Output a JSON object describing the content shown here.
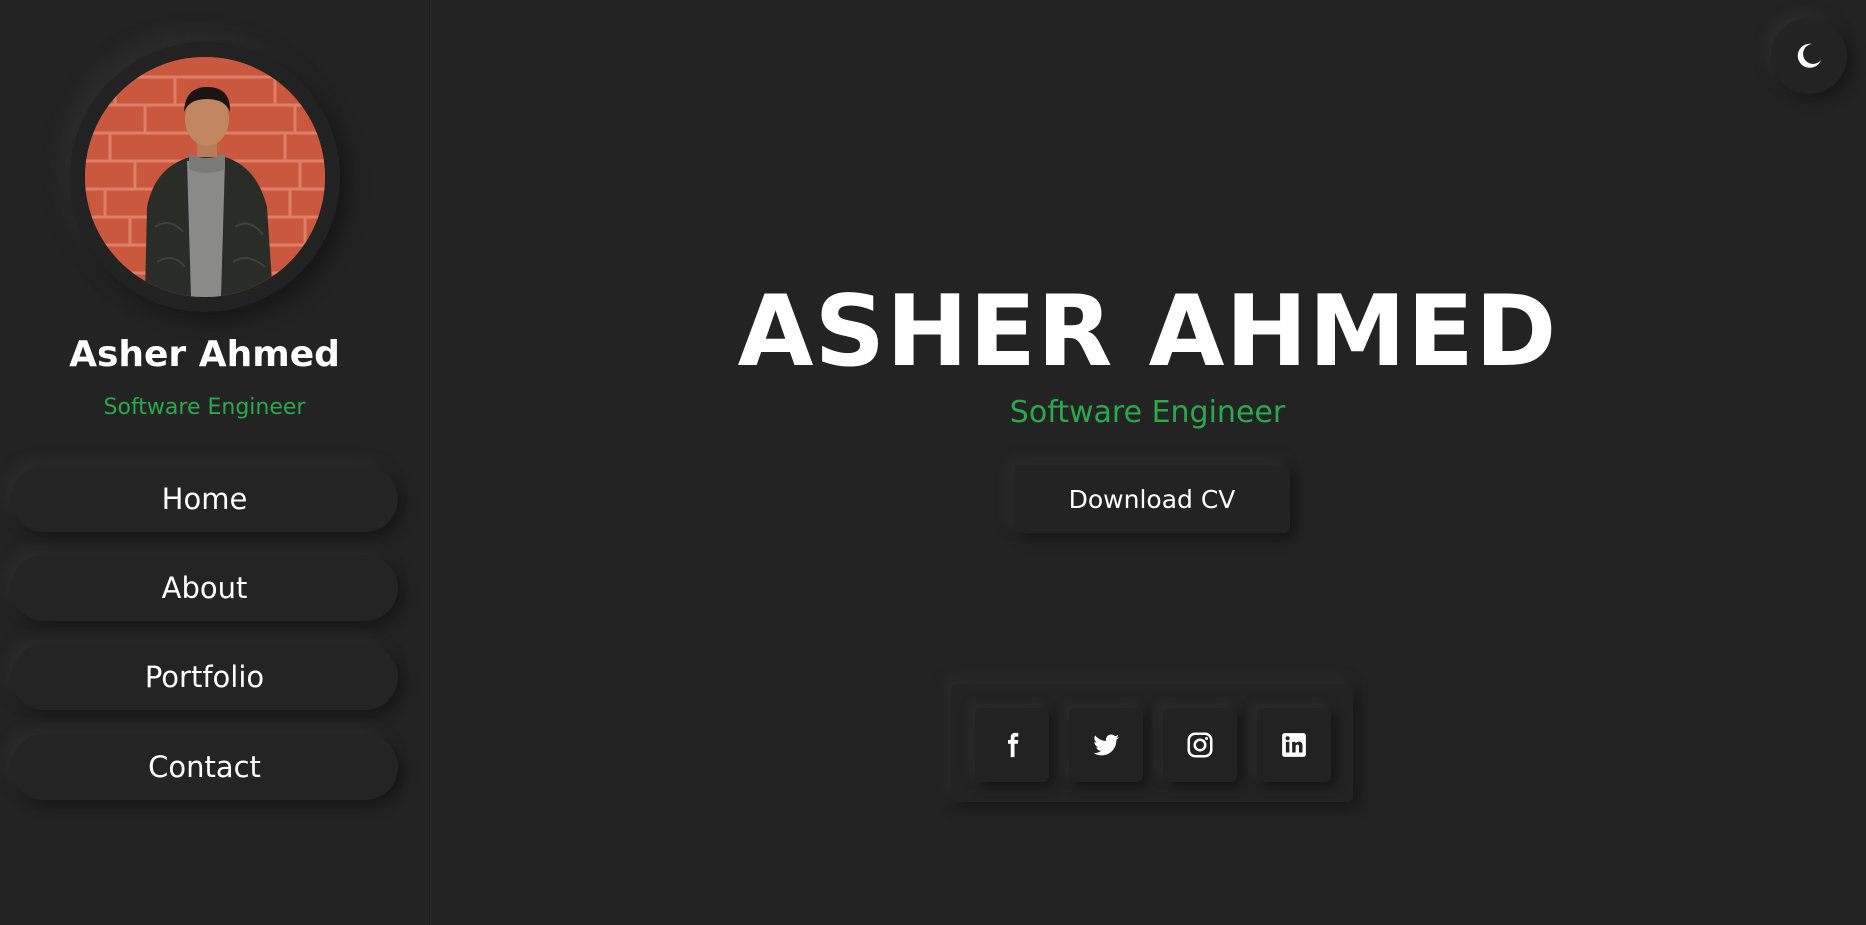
{
  "sidebar": {
    "name": "Asher Ahmed",
    "role": "Software Engineer",
    "nav": [
      {
        "label": "Home"
      },
      {
        "label": "About"
      },
      {
        "label": "Portfolio"
      },
      {
        "label": "Contact"
      }
    ]
  },
  "hero": {
    "title": "ASHER AHMED",
    "role": "Software Engineer",
    "cv_button": "Download CV"
  },
  "theme_toggle": {
    "icon": "moon-icon"
  },
  "social": [
    {
      "icon": "facebook-icon"
    },
    {
      "icon": "twitter-icon"
    },
    {
      "icon": "instagram-icon"
    },
    {
      "icon": "linkedin-icon"
    }
  ],
  "colors": {
    "background": "#232323",
    "accent": "#2aa84a",
    "text": "#ffffff"
  }
}
